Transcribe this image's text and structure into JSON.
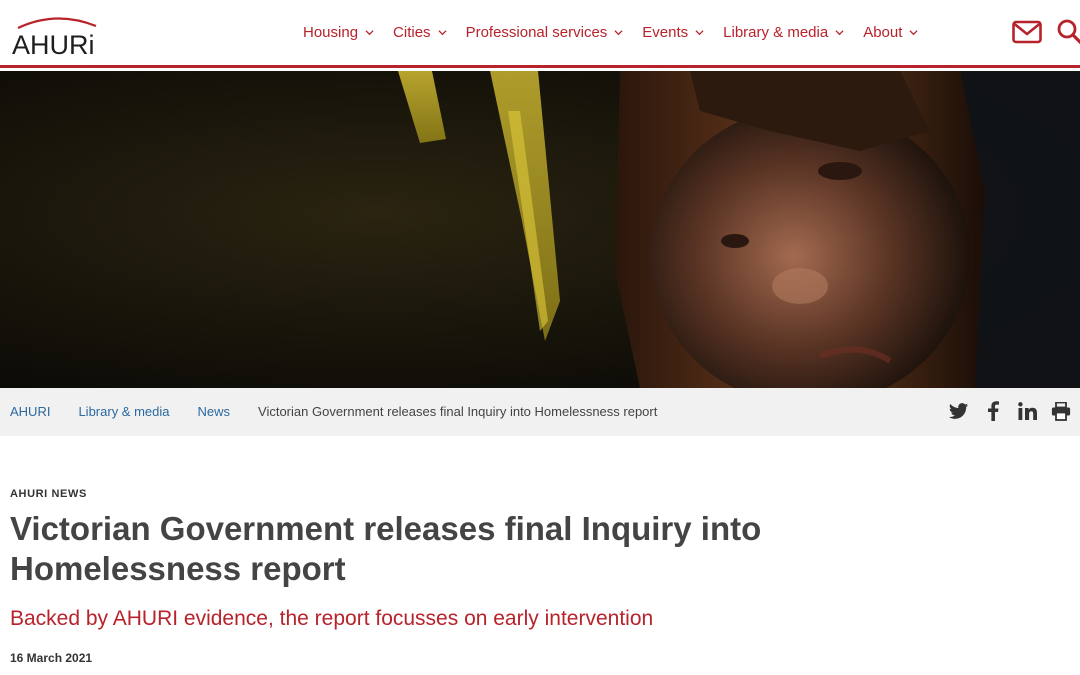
{
  "header": {
    "logo_text": "AHURi",
    "brand_color": "#b8222b",
    "nav": [
      {
        "label": "Housing",
        "icon": "chevron-down-icon"
      },
      {
        "label": "Cities",
        "icon": "chevron-down-icon"
      },
      {
        "label": "Professional services",
        "icon": "chevron-down-icon"
      },
      {
        "label": "Events",
        "icon": "chevron-down-icon"
      },
      {
        "label": "Library & media",
        "icon": "chevron-down-icon"
      },
      {
        "label": "About",
        "icon": "chevron-down-icon"
      }
    ],
    "icons": [
      "mail-icon",
      "search-icon"
    ]
  },
  "hero": {
    "image": "photo-of-child-in-dim-light"
  },
  "breadcrumb": {
    "links": [
      "AHURI",
      "Library & media",
      "News"
    ],
    "current": "Victorian Government releases final Inquiry into Homelessness report",
    "link_color": "#2b6aa0"
  },
  "share_icons": [
    "twitter-icon",
    "facebook-icon",
    "linkedin-icon",
    "print-icon"
  ],
  "article": {
    "kicker": "AHURI NEWS",
    "title": "Victorian Government releases final Inquiry into Homelessness report",
    "subtitle": "Backed by AHURI evidence, the report focusses on early intervention",
    "date": "16 March 2021"
  }
}
